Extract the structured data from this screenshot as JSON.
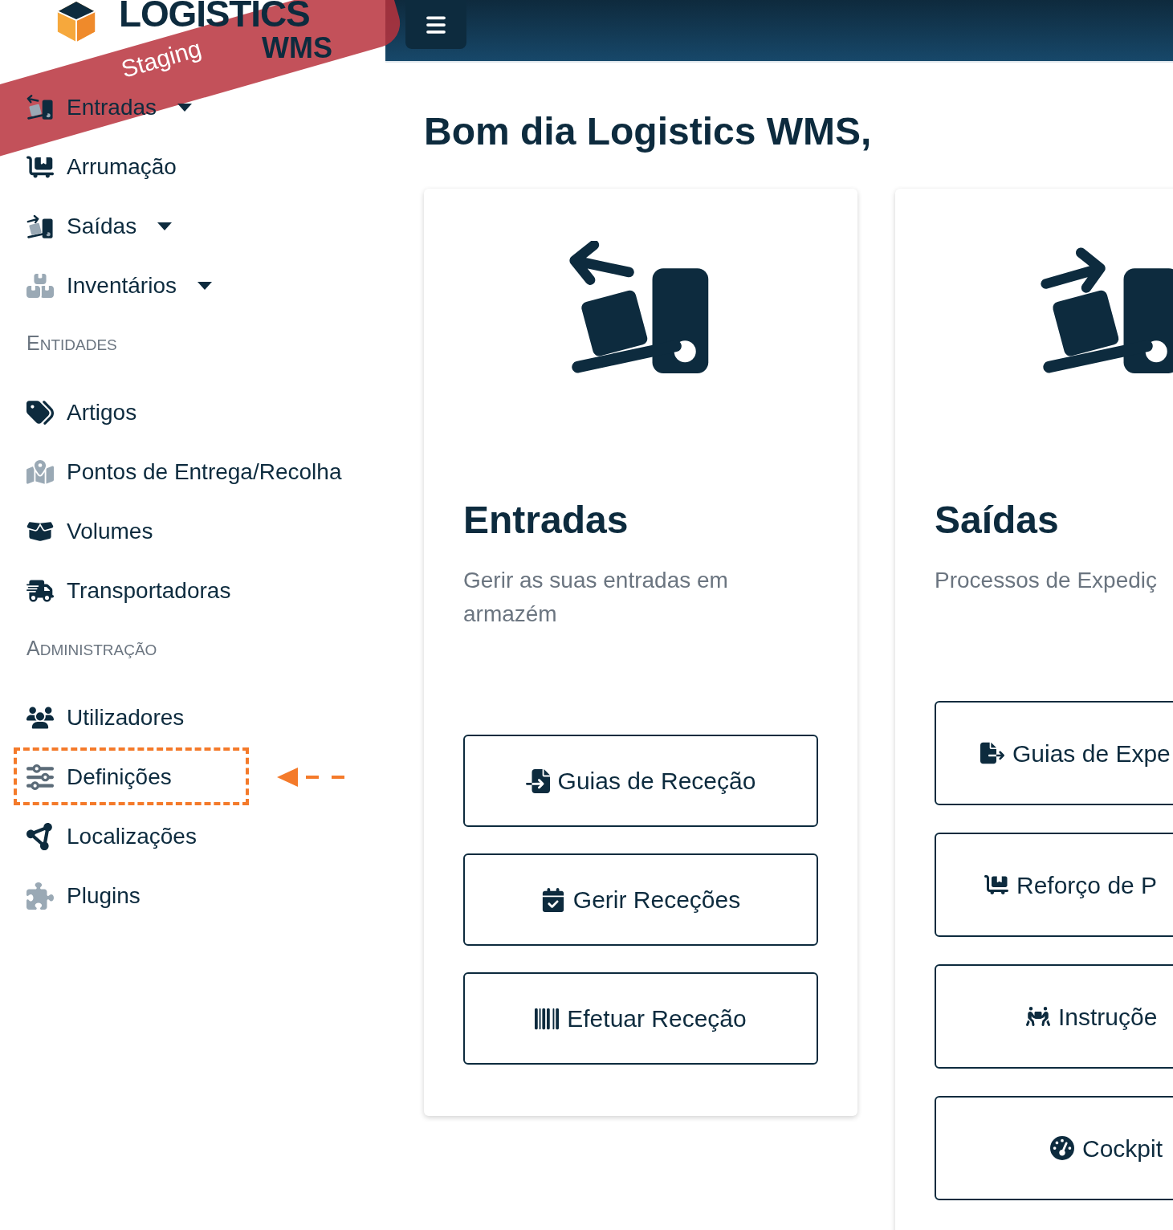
{
  "logo": {
    "title": "LOGISTICS",
    "subtitle": "WMS",
    "ribbon": "Staging"
  },
  "sidebar": {
    "groups": [
      {
        "items": [
          {
            "label": "Entradas",
            "has_submenu": true,
            "highlighted": false
          },
          {
            "label": "Arrumação",
            "has_submenu": false,
            "highlighted": false
          },
          {
            "label": "Saídas",
            "has_submenu": true,
            "highlighted": false
          },
          {
            "label": "Inventários",
            "has_submenu": true,
            "highlighted": false
          }
        ]
      },
      {
        "heading": "ENTIDADES",
        "items": [
          {
            "label": "Artigos",
            "has_submenu": false,
            "highlighted": false
          },
          {
            "label": "Pontos de Entrega/Recolha",
            "has_submenu": false,
            "highlighted": false
          },
          {
            "label": "Volumes",
            "has_submenu": false,
            "highlighted": false
          },
          {
            "label": "Transportadoras",
            "has_submenu": false,
            "highlighted": false
          }
        ]
      },
      {
        "heading": "ADMINISTRAÇÃO",
        "items": [
          {
            "label": "Utilizadores",
            "has_submenu": false,
            "highlighted": false
          },
          {
            "label": "Definições",
            "has_submenu": false,
            "highlighted": true
          },
          {
            "label": "Localizações",
            "has_submenu": false,
            "highlighted": false
          },
          {
            "label": "Plugins",
            "has_submenu": false,
            "highlighted": false
          }
        ]
      }
    ]
  },
  "greeting": "Bom dia Logistics WMS,",
  "cards": [
    {
      "title": "Entradas",
      "description": "Gerir as suas entradas em armazém",
      "buttons": [
        "Guias de Receção",
        "Gerir Receções",
        "Efetuar Receção"
      ]
    },
    {
      "title": "Saídas",
      "description": "Processos de Expediç",
      "buttons": [
        "Guias de Expe",
        "Reforço de P",
        "Instruçõe",
        "Cockpit"
      ]
    }
  ]
}
